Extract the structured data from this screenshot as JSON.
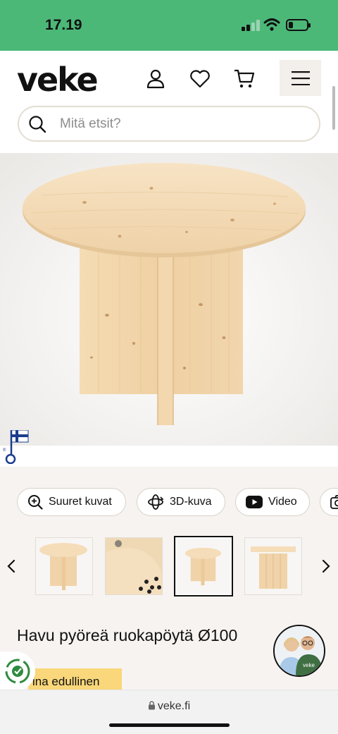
{
  "status_bar": {
    "time": "17.19"
  },
  "header": {
    "logo": "veke"
  },
  "search": {
    "placeholder": "Mitä etsit?"
  },
  "media_buttons": [
    {
      "label": "Suuret kuvat",
      "icon": "zoom-in-icon"
    },
    {
      "label": "3D-kuva",
      "icon": "rotate-3d-icon"
    },
    {
      "label": "Video",
      "icon": "youtube-icon"
    }
  ],
  "product": {
    "title": "Havu pyöreä ruokapöytä Ø100",
    "badge": "ina edullinen"
  },
  "avatar_shirt_text": "veke",
  "browser": {
    "url": "veke.fi"
  },
  "colors": {
    "status_bar": "#4cb878",
    "badge": "#f9d77a",
    "brand_dark": "#111111",
    "page_bg": "#f7f3f0"
  }
}
